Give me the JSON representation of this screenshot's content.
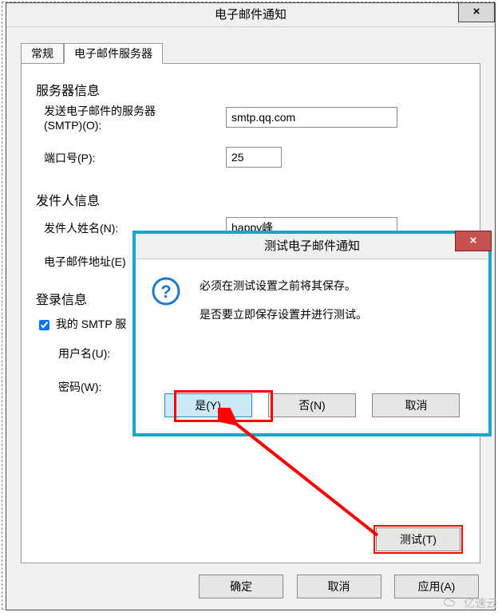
{
  "main_window": {
    "title": "电子邮件通知",
    "close_glyph": "×",
    "tabs": {
      "general": "常规",
      "email_server": "电子邮件服务器"
    },
    "buttons": {
      "ok": "确定",
      "cancel": "取消",
      "apply": "应用(A)",
      "test": "测试(T)"
    }
  },
  "server_info": {
    "section": "服务器信息",
    "smtp_label": "发送电子邮件的服务器(SMTP)(O):",
    "smtp_value": "smtp.qq.com",
    "port_label": "端口号(P):",
    "port_value": "25"
  },
  "sender_info": {
    "section": "发件人信息",
    "name_label": "发件人姓名(N):",
    "name_value": "happy峰",
    "email_label": "电子邮件地址(E)"
  },
  "login_info": {
    "section": "登录信息",
    "checkbox_label": "我的 SMTP 服",
    "username_label": "用户名(U):",
    "password_label": "密码(W):"
  },
  "modal": {
    "title": "测试电子邮件通知",
    "close_glyph": "×",
    "line1": "必须在测试设置之前将其保存。",
    "line2": "是否要立即保存设置并进行测试。",
    "yes": "是(Y)",
    "no": "否(N)",
    "cancel": "取消"
  },
  "watermark": "亿速云"
}
